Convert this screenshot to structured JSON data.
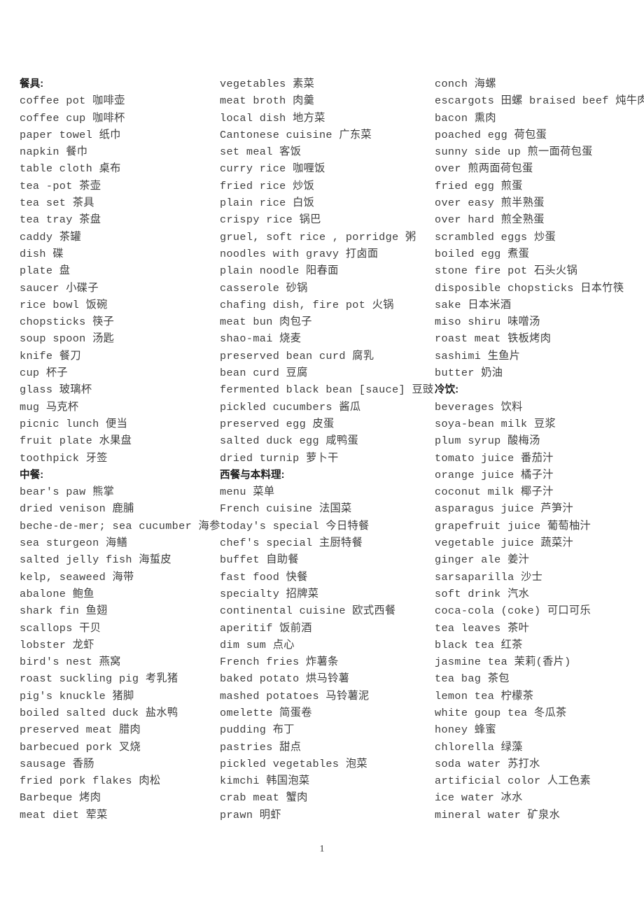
{
  "document": {
    "page_number": "1"
  },
  "columns": [
    {
      "id": "column-1",
      "entries": [
        {
          "text": "餐具:",
          "heading": true
        },
        {
          "text": "coffee pot 咖啡壶",
          "heading": false
        },
        {
          "text": "coffee cup 咖啡杯",
          "heading": false
        },
        {
          "text": "paper towel 纸巾",
          "heading": false
        },
        {
          "text": "napkin 餐巾",
          "heading": false
        },
        {
          "text": "table cloth 桌布",
          "heading": false
        },
        {
          "text": "tea -pot 茶壶",
          "heading": false
        },
        {
          "text": "tea set 茶具",
          "heading": false
        },
        {
          "text": "tea tray 茶盘",
          "heading": false
        },
        {
          "text": "caddy 茶罐",
          "heading": false
        },
        {
          "text": "dish 碟",
          "heading": false
        },
        {
          "text": "plate 盘",
          "heading": false
        },
        {
          "text": "saucer 小碟子",
          "heading": false
        },
        {
          "text": "rice bowl 饭碗",
          "heading": false
        },
        {
          "text": "chopsticks 筷子",
          "heading": false
        },
        {
          "text": "soup spoon 汤匙",
          "heading": false
        },
        {
          "text": "knife 餐刀",
          "heading": false
        },
        {
          "text": "cup 杯子",
          "heading": false
        },
        {
          "text": "glass 玻璃杯",
          "heading": false
        },
        {
          "text": "mug 马克杯",
          "heading": false
        },
        {
          "text": "picnic lunch 便当",
          "heading": false
        },
        {
          "text": "fruit plate 水果盘",
          "heading": false
        },
        {
          "text": "toothpick 牙签",
          "heading": false
        },
        {
          "text": "中餐:",
          "heading": true
        },
        {
          "text": "bear's paw 熊掌",
          "heading": false
        },
        {
          "text": "dried venison 鹿脯",
          "heading": false
        },
        {
          "text": "beche-de-mer; sea cucumber 海参",
          "heading": false
        },
        {
          "text": "sea sturgeon 海鳝",
          "heading": false
        },
        {
          "text": "salted jelly fish 海蜇皮",
          "heading": false
        },
        {
          "text": "kelp, seaweed 海带",
          "heading": false
        },
        {
          "text": "abalone 鲍鱼",
          "heading": false
        },
        {
          "text": "shark fin 鱼翅",
          "heading": false
        },
        {
          "text": "scallops 干贝",
          "heading": false
        },
        {
          "text": "lobster 龙虾",
          "heading": false
        },
        {
          "text": "bird's nest 燕窝",
          "heading": false
        },
        {
          "text": "roast suckling pig 考乳猪",
          "heading": false
        },
        {
          "text": "pig's knuckle 猪脚",
          "heading": false
        },
        {
          "text": "boiled salted duck 盐水鸭",
          "heading": false
        },
        {
          "text": "preserved meat 腊肉",
          "heading": false
        },
        {
          "text": "barbecued pork 叉烧",
          "heading": false
        },
        {
          "text": "sausage 香肠",
          "heading": false
        },
        {
          "text": "fried pork flakes 肉松",
          "heading": false
        },
        {
          "text": "Barbeque 烤肉",
          "heading": false
        },
        {
          "text": "meat diet 荤菜",
          "heading": false
        }
      ]
    },
    {
      "id": "column-2",
      "entries": [
        {
          "text": "vegetables 素菜",
          "heading": false
        },
        {
          "text": "meat broth 肉羹",
          "heading": false
        },
        {
          "text": "local dish 地方菜",
          "heading": false
        },
        {
          "text": "Cantonese cuisine 广东菜",
          "heading": false
        },
        {
          "text": "set meal 客饭",
          "heading": false
        },
        {
          "text": "curry rice 咖喱饭",
          "heading": false
        },
        {
          "text": "fried rice 炒饭",
          "heading": false
        },
        {
          "text": "plain rice 白饭",
          "heading": false
        },
        {
          "text": "crispy rice 锅巴",
          "heading": false
        },
        {
          "text": "gruel, soft rice , porridge 粥",
          "heading": false
        },
        {
          "text": "noodles with gravy 打卤面",
          "heading": false
        },
        {
          "text": "plain noodle 阳春面",
          "heading": false
        },
        {
          "text": "casserole 砂锅",
          "heading": false
        },
        {
          "text": "chafing dish, fire pot 火锅",
          "heading": false
        },
        {
          "text": "meat bun 肉包子",
          "heading": false
        },
        {
          "text": "shao-mai 烧麦",
          "heading": false
        },
        {
          "text": "preserved bean curd 腐乳",
          "heading": false
        },
        {
          "text": "bean curd 豆腐",
          "heading": false
        },
        {
          "text": "fermented black bean [sauce] 豆豉",
          "heading": false
        },
        {
          "text": "pickled cucumbers 酱瓜",
          "heading": false
        },
        {
          "text": "preserved egg 皮蛋",
          "heading": false
        },
        {
          "text": "salted duck egg 咸鸭蛋",
          "heading": false
        },
        {
          "text": "dried turnip 萝卜干",
          "heading": false
        },
        {
          "text": "西餐与本料理:",
          "heading": true
        },
        {
          "text": "menu 菜单",
          "heading": false
        },
        {
          "text": "French cuisine 法国菜",
          "heading": false
        },
        {
          "text": "today's special 今日特餐",
          "heading": false
        },
        {
          "text": "chef's special 主厨特餐",
          "heading": false
        },
        {
          "text": "buffet 自助餐",
          "heading": false
        },
        {
          "text": "fast food 快餐",
          "heading": false
        },
        {
          "text": "specialty 招牌菜",
          "heading": false
        },
        {
          "text": "continental cuisine 欧式西餐",
          "heading": false
        },
        {
          "text": "aperitif 饭前酒",
          "heading": false
        },
        {
          "text": "dim sum 点心",
          "heading": false
        },
        {
          "text": "French fries 炸薯条",
          "heading": false
        },
        {
          "text": "baked potato 烘马铃薯",
          "heading": false
        },
        {
          "text": "mashed potatoes 马铃薯泥",
          "heading": false
        },
        {
          "text": "omelette 简蛋卷",
          "heading": false
        },
        {
          "text": "pudding 布丁",
          "heading": false
        },
        {
          "text": "pastries 甜点",
          "heading": false
        },
        {
          "text": "pickled vegetables 泡菜",
          "heading": false
        },
        {
          "text": "kimchi 韩国泡菜",
          "heading": false
        },
        {
          "text": "crab meat 蟹肉",
          "heading": false
        },
        {
          "text": "prawn 明虾",
          "heading": false
        }
      ]
    },
    {
      "id": "column-3",
      "entries": [
        {
          "text": "conch 海螺",
          "heading": false
        },
        {
          "text": "escargots 田螺 braised beef 炖牛肉",
          "heading": false
        },
        {
          "text": "bacon 熏肉",
          "heading": false
        },
        {
          "text": "poached egg 荷包蛋",
          "heading": false
        },
        {
          "text": "sunny side up 煎一面荷包蛋",
          "heading": false
        },
        {
          "text": "over 煎两面荷包蛋",
          "heading": false
        },
        {
          "text": "fried egg 煎蛋",
          "heading": false
        },
        {
          "text": "over easy 煎半熟蛋",
          "heading": false
        },
        {
          "text": "over hard 煎全熟蛋",
          "heading": false
        },
        {
          "text": "scrambled eggs 炒蛋",
          "heading": false
        },
        {
          "text": "boiled egg 煮蛋",
          "heading": false
        },
        {
          "text": "stone fire pot 石头火锅",
          "heading": false
        },
        {
          "text": "disposible chopsticks 日本竹筷",
          "heading": false
        },
        {
          "text": "sake 日本米酒",
          "heading": false
        },
        {
          "text": "miso shiru 味噌汤",
          "heading": false
        },
        {
          "text": "roast meat 铁板烤肉",
          "heading": false
        },
        {
          "text": "sashimi 生鱼片",
          "heading": false
        },
        {
          "text": "butter 奶油",
          "heading": false
        },
        {
          "text": "冷饮:",
          "heading": true
        },
        {
          "text": "beverages 饮料",
          "heading": false
        },
        {
          "text": "soya-bean milk 豆浆",
          "heading": false
        },
        {
          "text": "plum syrup 酸梅汤",
          "heading": false
        },
        {
          "text": "tomato juice 番茄汁",
          "heading": false
        },
        {
          "text": "orange juice 橘子汁",
          "heading": false
        },
        {
          "text": "coconut milk 椰子汁",
          "heading": false
        },
        {
          "text": "asparagus juice  芦笋汁",
          "heading": false
        },
        {
          "text": "grapefruit juice 葡萄柚汁",
          "heading": false
        },
        {
          "text": "vegetable juice 蔬菜汁",
          "heading": false
        },
        {
          "text": "ginger ale 姜汁",
          "heading": false
        },
        {
          "text": "sarsaparilla 沙士",
          "heading": false
        },
        {
          "text": "soft drink 汽水",
          "heading": false
        },
        {
          "text": "coca-cola (coke) 可口可乐",
          "heading": false
        },
        {
          "text": "tea leaves 茶叶",
          "heading": false
        },
        {
          "text": "black tea 红茶",
          "heading": false
        },
        {
          "text": "jasmine tea 茉莉(香片)",
          "heading": false
        },
        {
          "text": "tea bag 茶包",
          "heading": false
        },
        {
          "text": "lemon tea 柠檬茶",
          "heading": false
        },
        {
          "text": "white goup tea 冬瓜茶",
          "heading": false
        },
        {
          "text": "honey 蜂蜜",
          "heading": false
        },
        {
          "text": "chlorella 绿藻",
          "heading": false
        },
        {
          "text": "soda water 苏打水",
          "heading": false
        },
        {
          "text": "artificial color 人工色素",
          "heading": false
        },
        {
          "text": "ice water 冰水",
          "heading": false
        },
        {
          "text": "mineral water 矿泉水",
          "heading": false
        }
      ]
    }
  ]
}
